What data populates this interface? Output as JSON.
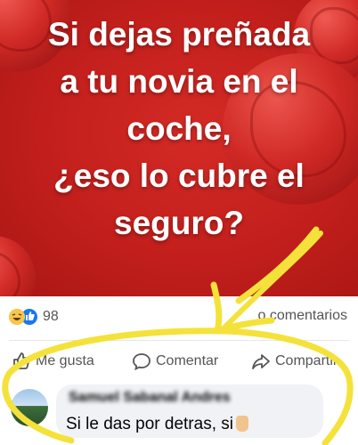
{
  "post": {
    "headline": [
      "Si dejas preñada",
      "a tu novia en el",
      "coche,",
      "¿eso lo cubre el",
      "seguro?"
    ]
  },
  "reactions": {
    "count": "98",
    "icons": [
      "haha-icon",
      "like-icon"
    ]
  },
  "comments_count": "o comentarios",
  "actions": {
    "like": "Me gusta",
    "comment": "Comentar",
    "share": "Compartir"
  },
  "comment": {
    "author": "Samuel Sabanal Andres",
    "text": "Si le das por detras, si"
  },
  "colors": {
    "banner_red": "#c21f1c",
    "highlight_yellow": "#f4e23a",
    "like_blue": "#1877f2"
  }
}
